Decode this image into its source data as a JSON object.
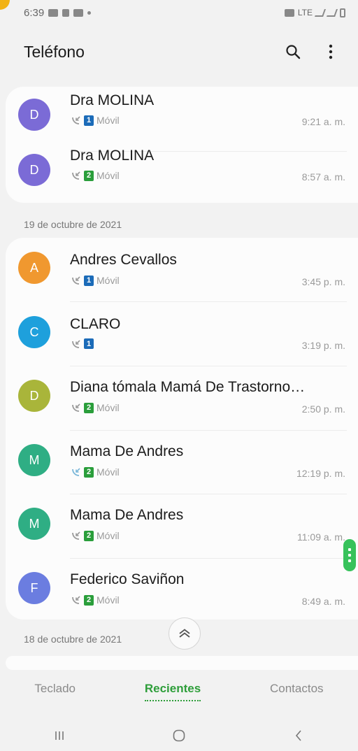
{
  "status_bar": {
    "time": "6:39",
    "network": "LTE"
  },
  "header": {
    "title": "Teléfono",
    "search_icon": "search-icon",
    "more_icon": "more-vertical-icon"
  },
  "groups": [
    {
      "date": "",
      "calls": [
        {
          "initial": "D",
          "name": "Dra MOLINA",
          "sim": "1",
          "label": "Móvil",
          "time": "9:21 a. m.",
          "avatar_color": "#7b6bd6"
        },
        {
          "initial": "D",
          "name": "Dra MOLINA",
          "sim": "2",
          "label": "Móvil",
          "time": "8:57 a. m.",
          "avatar_color": "#7b6bd6"
        }
      ]
    },
    {
      "date": "19 de octubre de 2021",
      "calls": [
        {
          "initial": "A",
          "name": "Andres Cevallos",
          "sim": "1",
          "label": "Móvil",
          "time": "3:45 p. m.",
          "avatar_color": "#f0982f"
        },
        {
          "initial": "C",
          "name": "CLARO",
          "sim": "1",
          "label": "",
          "time": "3:19 p. m.",
          "avatar_color": "#1ea0dc"
        },
        {
          "initial": "D",
          "name": "Diana tómala Mamá De Trastorno…",
          "sim": "2",
          "label": "Móvil",
          "time": "2:50 p. m.",
          "avatar_color": "#a9b53a"
        },
        {
          "initial": "M",
          "name": "Mama De Andres",
          "sim": "2",
          "label": "Móvil",
          "time": "12:19 p. m.",
          "avatar_color": "#2fae84"
        },
        {
          "initial": "M",
          "name": "Mama De Andres",
          "sim": "2",
          "label": "Móvil",
          "time": "11:09 a. m.",
          "avatar_color": "#2fae84"
        },
        {
          "initial": "F",
          "name": "Federico Saviñon",
          "sim": "2",
          "label": "Móvil",
          "time": "8:49 a. m.",
          "avatar_color": "#6b7de0"
        }
      ]
    },
    {
      "date": "18 de octubre de 2021",
      "calls": []
    }
  ],
  "tabs": [
    {
      "label": "Teclado",
      "active": false
    },
    {
      "label": "Recientes",
      "active": true
    },
    {
      "label": "Contactos",
      "active": false
    }
  ],
  "nav": {
    "recents_icon": "recent-apps-icon",
    "home_icon": "home-icon",
    "back_icon": "back-icon"
  },
  "colors": {
    "accent": "#2e9e3a",
    "sim1": "#1b6bb8",
    "sim2": "#2a9e3b"
  }
}
